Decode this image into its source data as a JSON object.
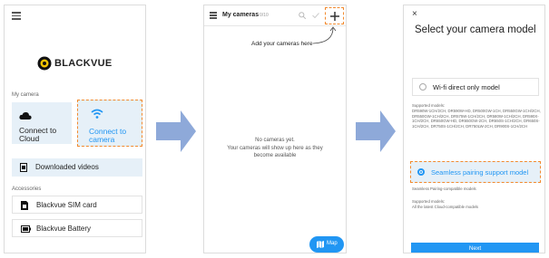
{
  "colors": {
    "accent": "#2196f3",
    "highlight": "#f28a2e",
    "tile": "#e6f0f8",
    "arrow": "#8ea9d9"
  },
  "screen1": {
    "logo": "BLACKVUE",
    "my_camera_label": "My camera",
    "tile_cloud": "Connect to Cloud",
    "tile_camera": "Connect to camera",
    "downloaded_videos": "Downloaded videos",
    "accessories_label": "Accessories",
    "sim_card": "Blackvue SIM card",
    "battery": "Blackvue Battery"
  },
  "screen2": {
    "title": "My cameras",
    "count": "0/10",
    "hint": "Add your cameras here",
    "empty_title": "No cameras yet.",
    "empty_body": "Your cameras will show up here as they become available",
    "map_button": "Map"
  },
  "screen3": {
    "close": "×",
    "title": "Select your camera model",
    "option_wifi": "Wi-fi direct only model",
    "supported_label": "Supported models:",
    "wifi_models": "DR590W-1CH/2CH, DR590W-HD, DR500GW-1CH, DR550GW-1CH/2CH, DR550GW-1CH/2CH, DR575W-1CH/2CH, DR580W-1CH/2CH, DR590X-1CH/2CH, DR650GW-HD, DR650GW-2CH, DR650S-1CH/2CH, DR650S-1CH/2CH, DR750S-1CH/2CH, DR750LW-2CH, DR900S-1CH/2CH",
    "option_seamless": "Seamless pairing support model",
    "seamless_note": "Seamless Pairing-compatible models",
    "seamless_supported_label": "Supported models:",
    "seamless_models": "All the latest Cloud-compatible models",
    "next": "Next"
  }
}
